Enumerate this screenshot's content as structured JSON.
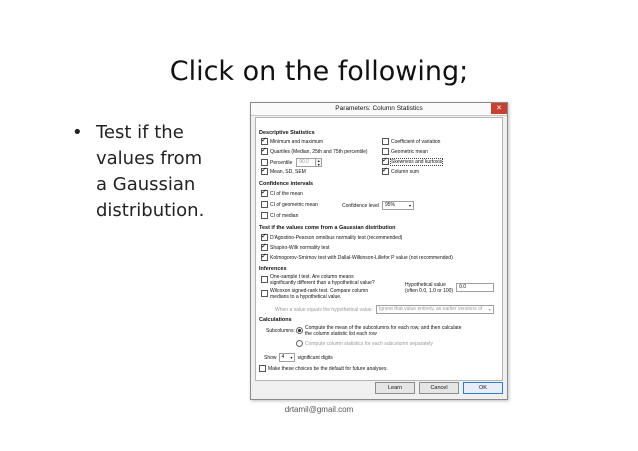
{
  "slide": {
    "title": "Click on the following;",
    "bullet_symbol": "•",
    "bullet_lines": [
      "Test if the",
      "values from",
      "a Gaussian",
      "distribution."
    ],
    "footer": "drtamil@gmail.com"
  },
  "dialog": {
    "title": "Parameters: Column Statistics",
    "close_glyph": "✕",
    "descriptive": {
      "header": "Descriptive Statistics",
      "minmax": "Minimum and maximum",
      "quartiles": "Quartiles (Median, 25th and 75th percentile)",
      "percentile": "Percentile",
      "percentile_value": "90.0",
      "mean_sd": "Mean, SD, SEM",
      "cv": "Coefficient of variation",
      "geomean": "Geometric mean",
      "skew": "Skewness and kurtosis",
      "colsum": "Column sum"
    },
    "ci": {
      "header": "Confidence intervals",
      "mean": "CI of the mean",
      "geomean": "CI of geometric mean",
      "median": "CI of median",
      "level_label": "Confidence level",
      "level_value": "95%"
    },
    "gaussian": {
      "header": "Test if the values come from a Gaussian distribution",
      "dagostino": "D'Agostino-Pearson omnibus normality test (recommended)",
      "shapiro": "Shapiro-Wilk normality test",
      "ks": "Kolmogorov-Smirnov test with Dallal-Wilkinson-Lillefor P value (not recommended)"
    },
    "inferences": {
      "header": "Inferences",
      "ttest_1": "One-sample t test. Are column means",
      "ttest_2": "significantly different than a hypothetical value?",
      "wilcoxon_1": "Wilcoxon signed-rank test. Compare column",
      "wilcoxon_2": "medians to a hypothetical value.",
      "hyp_label_1": "Hypothetical value",
      "hyp_label_2": "(often 0.0, 1.0 or 100)",
      "hyp_value": "0.0",
      "equals_label": "When a value equals the hypothetical value:",
      "equals_value": "Ignore that value entirely, as earlier versions of"
    },
    "calculations": {
      "header": "Calculations",
      "subcolumns_label": "Subcolumns:",
      "opt1_1": "Compute the mean of the subcolumns for each row, and then calculate",
      "opt1_2": "the column statistic list each row",
      "opt2": "Compute column statistics for each subcolumn separately",
      "show_label": "Show",
      "show_value": "4",
      "digits_label": "significant digits"
    },
    "default_label": "Make these choices be the default for future analyses.",
    "buttons": {
      "learn": "Learn",
      "cancel": "Cancel",
      "ok": "OK"
    }
  }
}
